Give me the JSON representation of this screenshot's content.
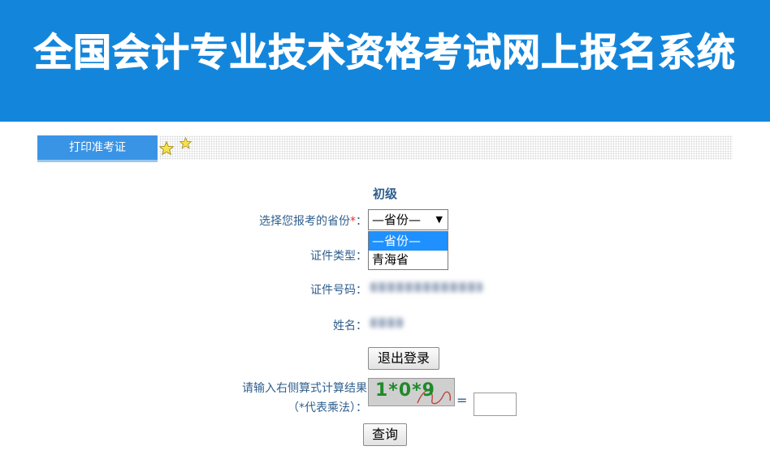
{
  "header": {
    "title": "全国会计专业技术资格考试网上报名系统",
    "bg_color": "#1386dc"
  },
  "tabs": {
    "print_admission_ticket": "打印准考证"
  },
  "form": {
    "level": "初级",
    "province_label": "选择您报考的省份",
    "required_mark": "*",
    "colon": "：",
    "province_select": {
      "selected": "—省份—",
      "options": [
        "—省份—",
        "青海省"
      ]
    },
    "id_type_label": "证件类型：",
    "id_number_label": "证件号码：",
    "name_label": "姓名：",
    "logout_button": "退出登录",
    "captcha_label_line1": "请输入右侧算式计算结果",
    "captcha_label_line2": "（*代表乘法）：",
    "captcha_text": "1*0*9",
    "equals": "=",
    "answer_value": "",
    "query_button": "查询"
  },
  "colors": {
    "accent": "#1386dc",
    "tab": "#3a94e6",
    "label": "#2f5f8e",
    "required": "#e03030"
  },
  "icons": [
    "star-icon",
    "star-icon"
  ]
}
